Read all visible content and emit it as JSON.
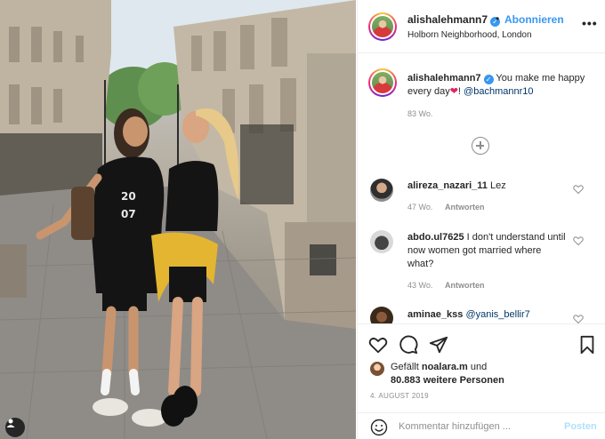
{
  "post": {
    "username": "alishalehmann7",
    "verified_icon": "verified-badge-icon",
    "dot": "•",
    "follow_label": "Abonnieren",
    "location": "Holborn Neighborhood, London",
    "more_label": "•••"
  },
  "caption": {
    "username": "alishalehmann7",
    "text_before": "You make me happy every day",
    "heart": "❤",
    "text_after": "! ",
    "mention": "@bachmannr10",
    "time": "83 Wo."
  },
  "comments": [
    {
      "username": "alireza_nazari_11",
      "text": "Lez",
      "mention": "",
      "time": "47 Wo.",
      "reply_label": "Antworten"
    },
    {
      "username": "abdo.ul7625",
      "text": "I don't understand until now women got married where what?",
      "mention": "",
      "time": "43 Wo.",
      "reply_label": "Antworten"
    },
    {
      "username": "aminae_kss",
      "text": "",
      "mention": "@yanis_bellir7",
      "time": "",
      "reply_label": ""
    }
  ],
  "likes": {
    "prefix": "Gefällt",
    "username": "noalara.m",
    "suffix": "und",
    "line2": "80.883 weitere Personen"
  },
  "date": "4. AUGUST 2019",
  "comment_input": {
    "placeholder": "Kommentar hinzufügen ...",
    "post_label": "Posten"
  },
  "colors": {
    "link_blue": "#3897f0",
    "text_dark": "#262626",
    "text_muted": "#8e8e8e",
    "heart_red": "#e0245e",
    "post_disabled": "#b2dffc"
  }
}
